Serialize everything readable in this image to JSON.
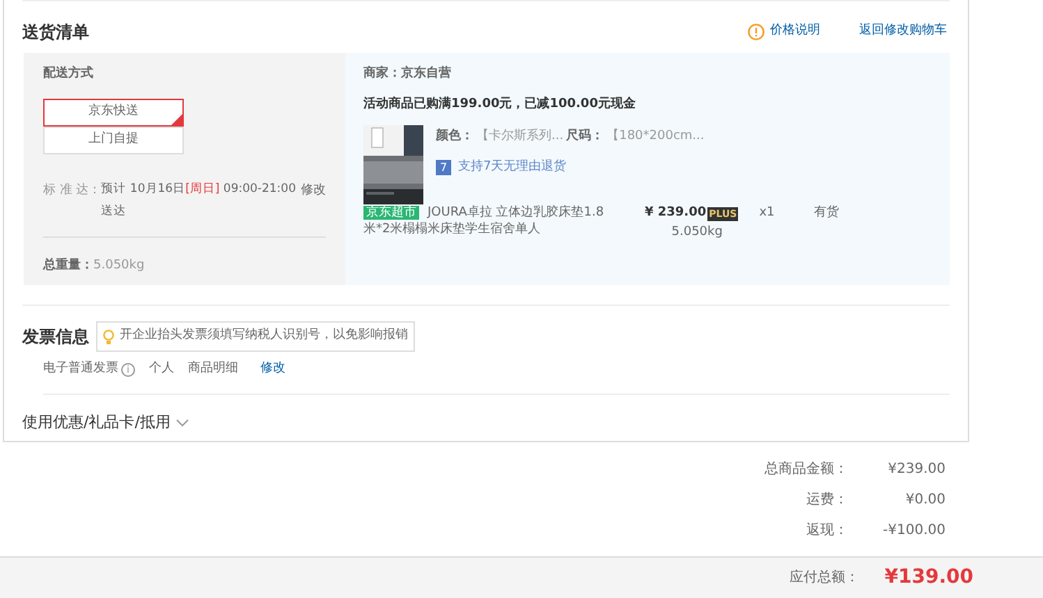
{
  "delivery_list": {
    "title": "送货清单",
    "price_note": "价格说明",
    "back_link": "返回修改购物车",
    "shipping": {
      "label": "配送方式",
      "options": [
        {
          "label": "京东快送",
          "selected": true
        },
        {
          "label": "上门自提",
          "selected": false
        }
      ],
      "eta_label": "标 准 达：",
      "eta_prefix": "预计 10月16日",
      "eta_weekday": "[周日]",
      "eta_time": " 09:00-21:00 送达",
      "eta_edit": "修改",
      "weight_label": "总重量：",
      "weight": "5.050kg"
    },
    "shop": {
      "seller": "商家：京东自营",
      "promo": "活动商品已购满199.00元，已减100.00元现金",
      "item": {
        "color_label": "颜色：",
        "color_value": "【卡尔斯系列...",
        "size_label": "尺码：",
        "size": "【180*200cm...",
        "return_badge": "7",
        "return_policy": "支持7天无理由退货",
        "tag": "京东超市",
        "name": "JOURA卓拉 立体边乳胶床垫1.8米*2米榻榻米床垫学生宿舍单人",
        "price": "¥ 239.00",
        "plus": "PLUS",
        "weight": "5.050kg",
        "qty": "x1",
        "stock": "有货"
      }
    }
  },
  "invoice": {
    "title": "发票信息",
    "tip": "开企业抬头发票须填写纳税人识别号，以免影响报销",
    "type": "电子普通发票",
    "info_icon": "i",
    "header": "个人",
    "content": "商品明细",
    "edit": "修改"
  },
  "coupon": {
    "title": "使用优惠/礼品卡/抵用",
    "expanded": false
  },
  "totals": [
    {
      "label": "总商品金额：",
      "value": "¥239.00"
    },
    {
      "label": "运费：",
      "value": "¥0.00"
    },
    {
      "label": "返现：",
      "value": "-¥100.00"
    }
  ],
  "payable": {
    "label": "应付总额：",
    "value": "¥139.00"
  }
}
